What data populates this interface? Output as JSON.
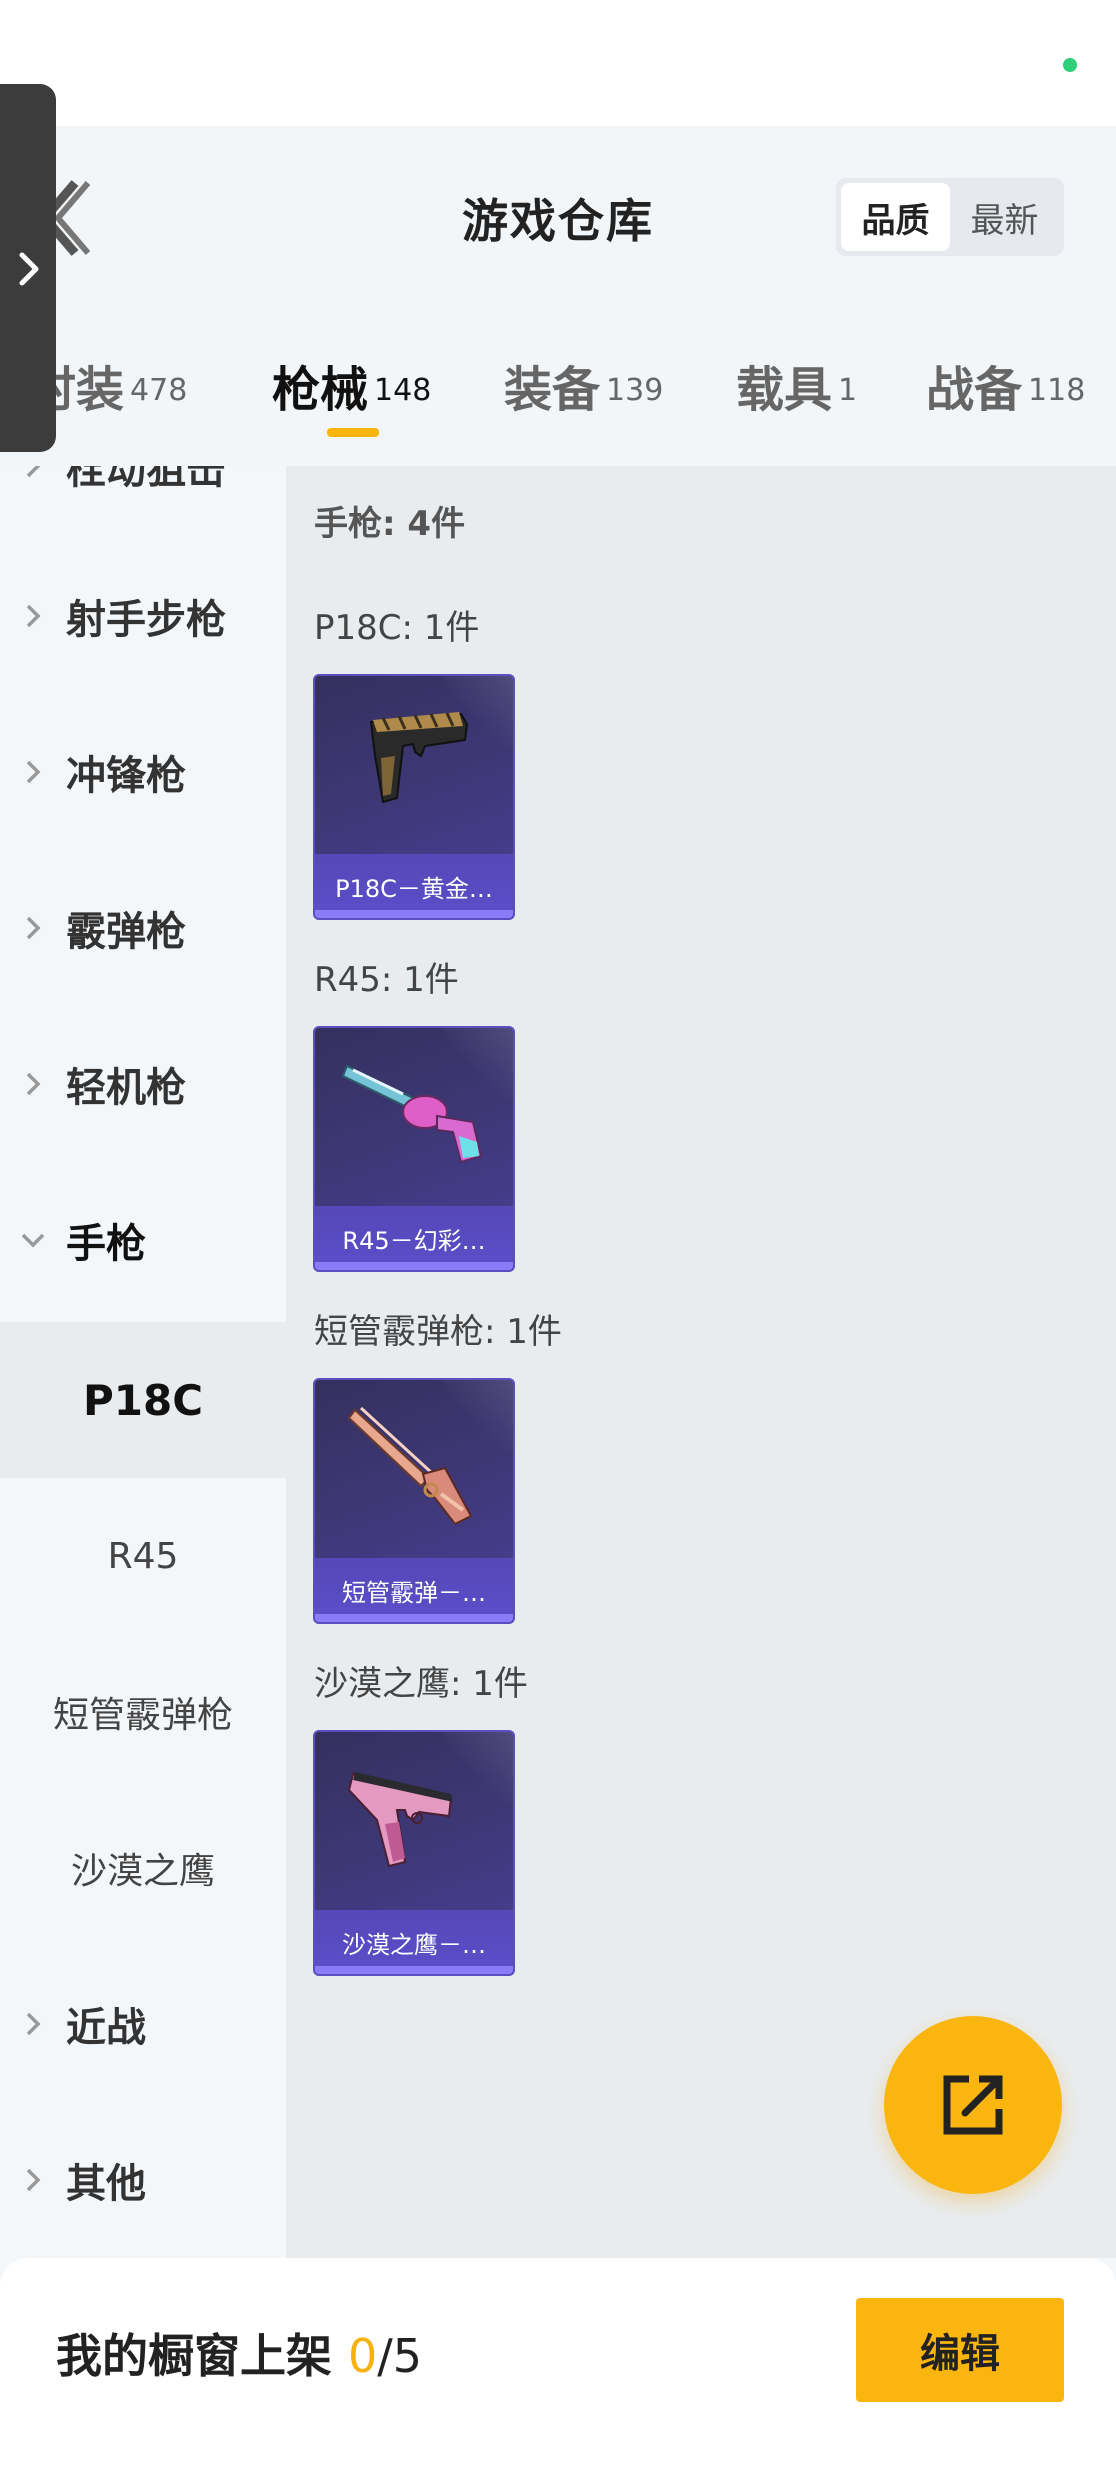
{
  "header": {
    "title": "游戏仓库",
    "sort": {
      "options": [
        "品质",
        "最新"
      ],
      "selected": "品质"
    }
  },
  "tabs": [
    {
      "label": "时装",
      "count": "478"
    },
    {
      "label": "枪械",
      "count": "148",
      "active": true
    },
    {
      "label": "装备",
      "count": "139"
    },
    {
      "label": "载具",
      "count": "1"
    },
    {
      "label": "战备",
      "count": "118"
    }
  ],
  "sidebar": {
    "partial_top": "栓动狙击",
    "categories": [
      {
        "label": "射手步枪",
        "expanded": false
      },
      {
        "label": "冲锋枪",
        "expanded": false
      },
      {
        "label": "霰弹枪",
        "expanded": false
      },
      {
        "label": "轻机枪",
        "expanded": false
      },
      {
        "label": "手枪",
        "expanded": true
      },
      {
        "label": "近战",
        "expanded": false
      },
      {
        "label": "其他",
        "expanded": false
      }
    ],
    "subcategories": [
      "P18C",
      "R45",
      "短管霰弹枪",
      "沙漠之鹰"
    ],
    "active_subcategory": "P18C"
  },
  "content": {
    "section_title": "手枪: 4件",
    "groups": [
      {
        "title": "P18C: 1件",
        "item_name": "P18C－黄金…",
        "weapon_icon": "pistol-gold-icon"
      },
      {
        "title": "R45: 1件",
        "item_name": "R45－幻彩…",
        "weapon_icon": "revolver-rainbow-icon"
      },
      {
        "title": "短管霰弹枪: 1件",
        "item_name": "短管霰弹－…",
        "weapon_icon": "sawed-off-shotgun-icon"
      },
      {
        "title": "沙漠之鹰: 1件",
        "item_name": "沙漠之鹰－…",
        "weapon_icon": "desert-eagle-pink-icon"
      }
    ]
  },
  "fab": {
    "icon": "share-external-icon"
  },
  "footer": {
    "label": "我的橱窗上架",
    "used": "0",
    "slash": "/",
    "total": "5",
    "edit_label": "编辑"
  },
  "colors": {
    "accent": "#fbb50f",
    "card_bg": "#3d3775",
    "card_border": "#5a4fc0",
    "status_dot": "#2fcf7a"
  }
}
